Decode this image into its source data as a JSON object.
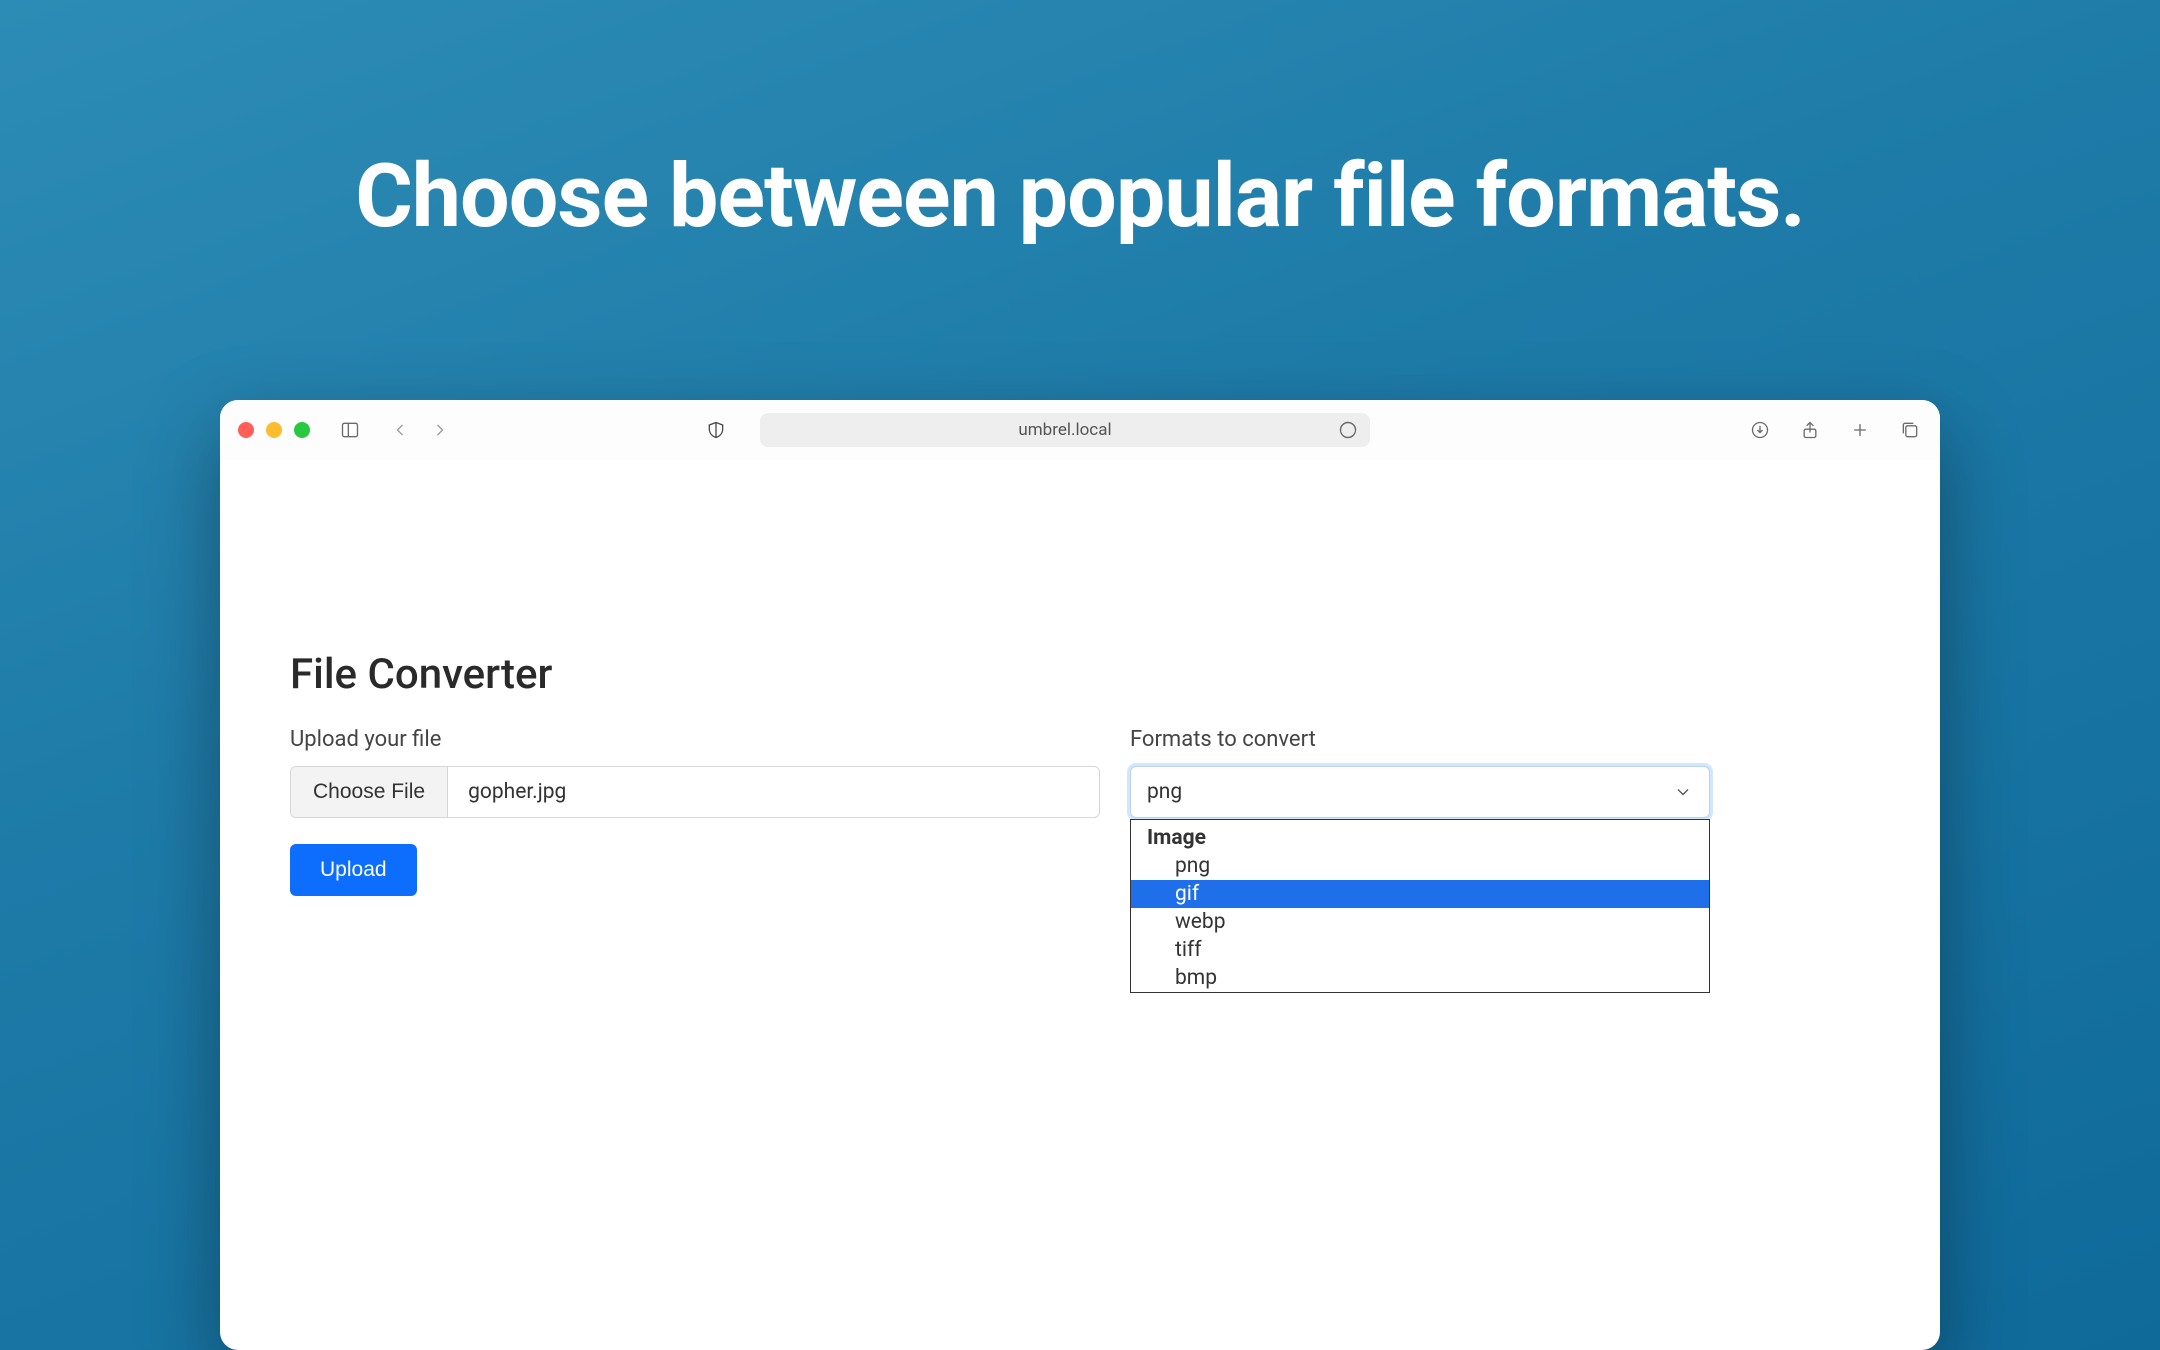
{
  "hero": {
    "title": "Choose between popular file formats."
  },
  "browser": {
    "url": "umbrel.local"
  },
  "app": {
    "title": "File Converter",
    "upload_label": "Upload your file",
    "choose_file_label": "Choose File",
    "selected_file": "gopher.jpg",
    "upload_button": "Upload",
    "format_label": "Formats to convert",
    "format_selected": "png",
    "dropdown": {
      "group": "Image",
      "options": [
        "png",
        "gif",
        "webp",
        "tiff",
        "bmp"
      ],
      "highlighted": "gif"
    }
  }
}
